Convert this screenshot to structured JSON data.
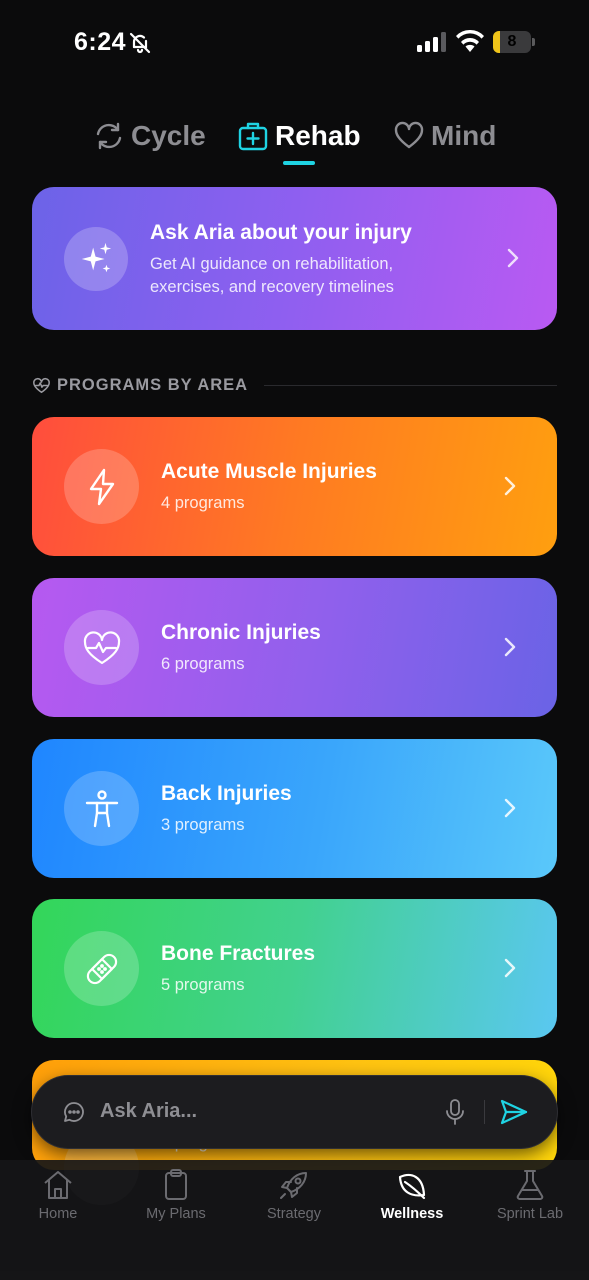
{
  "status": {
    "time": "6:24",
    "battery": "8",
    "battery_level": 0.08
  },
  "tabs": [
    {
      "label": "Cycle",
      "icon": "refresh-icon",
      "active": false
    },
    {
      "label": "Rehab",
      "icon": "medical-kit-icon",
      "active": true
    },
    {
      "label": "Mind",
      "icon": "heart-icon",
      "active": false
    }
  ],
  "hero": {
    "title": "Ask Aria about your injury",
    "description": "Get AI guidance on rehabilitation, exercises, and recovery timelines",
    "icon": "sparkles-icon"
  },
  "section": {
    "label": "PROGRAMS BY AREA",
    "icon": "heart-pulse-icon"
  },
  "programs": [
    {
      "title": "Acute Muscle Injuries",
      "count": "4 programs",
      "icon": "lightning-icon",
      "colors": [
        "#ff4d3d",
        "#ff9f0f"
      ]
    },
    {
      "title": "Chronic Injuries",
      "count": "6 programs",
      "icon": "heart-pulse-icon",
      "colors": [
        "#b659f0",
        "#6a63e6"
      ]
    },
    {
      "title": "Back Injuries",
      "count": "3 programs",
      "icon": "person-figure-icon",
      "colors": [
        "#1f86ff",
        "#5ac8fa"
      ]
    },
    {
      "title": "Bone Fractures",
      "count": "5 programs",
      "icon": "bandage-icon",
      "colors": [
        "#33d659",
        "#5ac7f1"
      ]
    },
    {
      "title": "",
      "count": "3 programs",
      "icon": "",
      "colors": [
        "#ff9f0a",
        "#ffd60a"
      ]
    }
  ],
  "ask": {
    "placeholder": "Ask Aria...",
    "accent": "#1fd3e3"
  },
  "tabbar": [
    {
      "label": "Home",
      "icon": "house-icon",
      "active": false
    },
    {
      "label": "My Plans",
      "icon": "clipboard-icon",
      "active": false
    },
    {
      "label": "Strategy",
      "icon": "rocket-icon",
      "active": false
    },
    {
      "label": "Wellness",
      "icon": "leaf-icon",
      "active": true
    },
    {
      "label": "Sprint Lab",
      "icon": "flask-icon",
      "active": false
    }
  ]
}
